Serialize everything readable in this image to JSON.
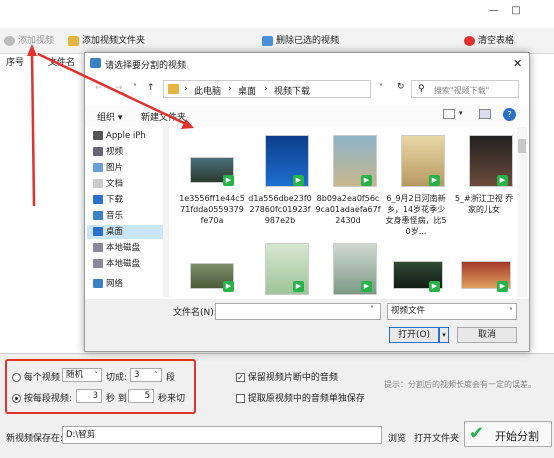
{
  "titlebar": {
    "minimize": "—",
    "maximize": "□"
  },
  "toolbar": {
    "add_video": "添加视频",
    "add_folder": "添加视频文件夹",
    "remove_selected": "删除已选的视频",
    "clear_table": "清空表格"
  },
  "table": {
    "columns": [
      "序号",
      "文件名"
    ]
  },
  "dialog": {
    "title": "请选择要分割的视频",
    "close": "✕",
    "breadcrumb": [
      "此电脑",
      "桌面",
      "视频下载"
    ],
    "search_placeholder": "搜索\"视频下载\"",
    "organize": "组织 ▾",
    "new_folder": "新建文件夹",
    "sidebar": [
      "Apple iPh",
      "视频",
      "图片",
      "文档",
      "下载",
      "音乐",
      "桌面",
      "本地磁盘",
      "本地磁盘",
      "网络"
    ],
    "files_row1": [
      {
        "name": "1e3556ff1e44c571fdda0559379fe70a"
      },
      {
        "name": "d1a556dbe23f027860fc01923f987e2b"
      },
      {
        "name": "8b09a2ea0f56c9ca01adaefa67f2430d"
      },
      {
        "name": "6_9月2日河南新乡，14岁花季少女身患怪病，比50岁..."
      },
      {
        "name": "5_#浙江卫视 乔家的儿女"
      }
    ],
    "filename_label": "文件名(N):",
    "filename_value": "",
    "filetype": "视频文件",
    "open_button": "打开(O)",
    "cancel_button": "取消"
  },
  "options": {
    "per_video": "每个视频",
    "random": "随机",
    "cut_into": "切成:",
    "cut_count": "3",
    "segments": "段",
    "by_segment": "按每段视频:",
    "from_sec": "3",
    "sec_to": "秒 到",
    "to_sec": "5",
    "sec_cut": "秒来切",
    "keep_audio": "保留视频片断中的音频",
    "extract_audio": "提取原视频中的音频单独保存",
    "hint": "提示：分割后的视频长度会有一定的误差。"
  },
  "save": {
    "label": "新视频保存在:",
    "path": "D:\\智剪",
    "browse": "浏览",
    "open_folder": "打开文件夹",
    "start": "开始分割"
  },
  "colors": {
    "accent_red": "#e0332f",
    "green": "#27b24a"
  }
}
